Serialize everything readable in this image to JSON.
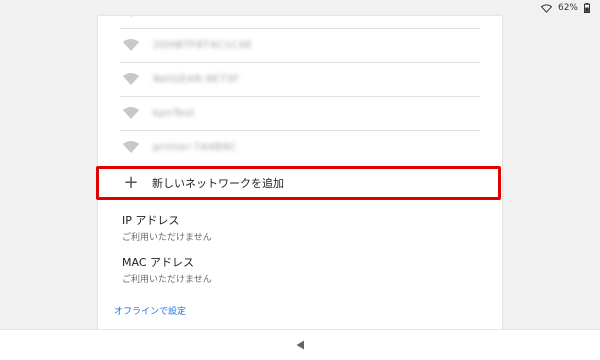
{
  "status_bar": {
    "battery_percent": "62%",
    "wifi_icon": "wifi-icon",
    "battery_icon": "battery-icon"
  },
  "networks": [
    {
      "ssid": "2DHBTF8T4C1C4E",
      "icon": "wifi-icon"
    },
    {
      "ssid": "NetGEAR-9E73F",
      "icon": "wifi-icon"
    },
    {
      "ssid": "kpnTest",
      "icon": "wifi-icon"
    },
    {
      "ssid": "printer-7A4B9C",
      "icon": "wifi-icon"
    }
  ],
  "add_network": {
    "icon": "plus-icon",
    "label": "新しいネットワークを追加"
  },
  "ip_address": {
    "title": "IP アドレス",
    "value": "ご利用いただけません"
  },
  "mac_address": {
    "title": "MAC アドレス",
    "value": "ご利用いただけません"
  },
  "offline_link": "オフラインで設定",
  "colors": {
    "highlight": "#e10000",
    "link": "#1a73e8"
  }
}
